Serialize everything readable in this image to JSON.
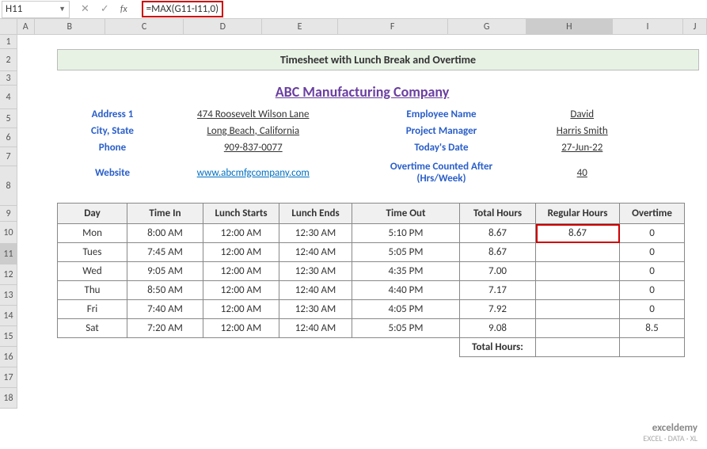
{
  "name_box": "H11",
  "formula": "=MAX(G11-I11,0)",
  "columns": [
    "A",
    "B",
    "C",
    "D",
    "E",
    "F",
    "G",
    "H",
    "I",
    "J"
  ],
  "rows": [
    "1",
    "2",
    "3",
    "4",
    "5",
    "6",
    "7",
    "8",
    "9",
    "10",
    "11",
    "12",
    "13",
    "14",
    "15",
    "16",
    "17",
    "18"
  ],
  "selected_col": "H",
  "selected_row": "11",
  "title_band": "Timesheet with Lunch Break and Overtime",
  "company": "ABC Manufacturing Company",
  "left_info": [
    {
      "label": "Address 1",
      "value": "474 Roosevelt Wilson Lane"
    },
    {
      "label": "City, State",
      "value": "Long Beach, California"
    },
    {
      "label": "Phone",
      "value": "909-837-0077"
    },
    {
      "label": "Website",
      "value": "www.abcmfgcompany.com",
      "link": true
    }
  ],
  "right_info": [
    {
      "label": "Employee Name",
      "value": "David"
    },
    {
      "label": "Project Manager",
      "value": "Harris Smith"
    },
    {
      "label": "Today's Date",
      "value": "27-Jun-22"
    },
    {
      "label": "Overtime Counted After (Hrs/Week)",
      "value": "40"
    }
  ],
  "headers": [
    "Day",
    "Time In",
    "Lunch Starts",
    "Lunch Ends",
    "Time Out",
    "Total Hours",
    "Regular Hours",
    "Overtime"
  ],
  "data_rows": [
    {
      "day": "Mon",
      "in": "8:00 AM",
      "ls": "12:00 AM",
      "le": "12:30 AM",
      "out": "5:10 PM",
      "tot": "8.67",
      "reg": "8.67",
      "ot": "0",
      "hl": true
    },
    {
      "day": "Tues",
      "in": "7:45 AM",
      "ls": "12:00 AM",
      "le": "12:40 AM",
      "out": "5:05 PM",
      "tot": "8.67",
      "reg": "",
      "ot": "0"
    },
    {
      "day": "Wed",
      "in": "9:05 AM",
      "ls": "12:00 AM",
      "le": "12:30 AM",
      "out": "4:35 PM",
      "tot": "7.00",
      "reg": "",
      "ot": "0"
    },
    {
      "day": "Thu",
      "in": "8:50 AM",
      "ls": "12:00 AM",
      "le": "12:40 AM",
      "out": "4:40 PM",
      "tot": "7.17",
      "reg": "",
      "ot": "0"
    },
    {
      "day": "Fri",
      "in": "7:40 AM",
      "ls": "12:00 AM",
      "le": "12:30 AM",
      "out": "4:05 PM",
      "tot": "7.92",
      "reg": "",
      "ot": "0"
    },
    {
      "day": "Sat",
      "in": "7:20 AM",
      "ls": "12:00 AM",
      "le": "12:40 AM",
      "out": "5:05 PM",
      "tot": "9.08",
      "reg": "",
      "ot": "8.5"
    }
  ],
  "total_label": "Total Hours:",
  "watermark": {
    "brand": "exceldemy",
    "tag": "EXCEL · DATA · XL"
  }
}
